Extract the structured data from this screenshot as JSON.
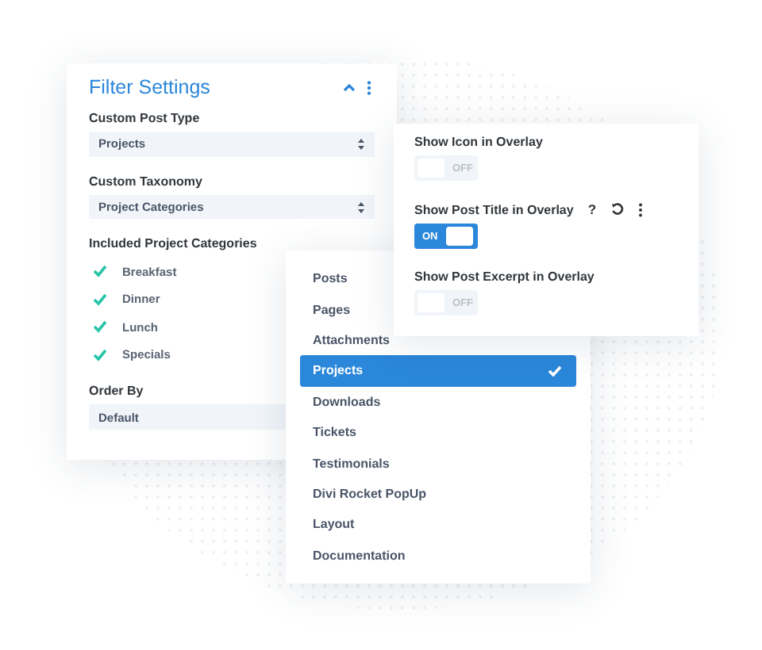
{
  "filter_panel": {
    "title": "Filter Settings",
    "fields": [
      {
        "label": "Custom Post Type",
        "value": "Projects"
      },
      {
        "label": "Custom Taxonomy",
        "value": "Project Categories"
      }
    ],
    "categories_label": "Included Project Categories",
    "categories": [
      {
        "label": "Breakfast",
        "checked": true
      },
      {
        "label": "Dinner",
        "checked": true
      },
      {
        "label": "Lunch",
        "checked": true
      },
      {
        "label": "Specials",
        "checked": true
      }
    ],
    "order_by": {
      "label": "Order By",
      "value": "Default"
    }
  },
  "overlay_panel": {
    "toggles": [
      {
        "label": "Show Icon in Overlay",
        "on": false,
        "text": "OFF"
      },
      {
        "label": "Show Post Title in Overlay",
        "on": true,
        "text": "ON",
        "actions": [
          {
            "kind": "help",
            "text": "?"
          },
          {
            "kind": "reset"
          },
          {
            "kind": "more"
          }
        ]
      },
      {
        "label": "Show Post Excerpt in Overlay",
        "on": false,
        "text": "OFF"
      }
    ]
  },
  "post_type_menu": {
    "items": [
      {
        "label": "Posts",
        "selected": false
      },
      {
        "label": "Pages",
        "selected": false
      },
      {
        "label": "Attachments",
        "selected": false
      },
      {
        "label": "Projects",
        "selected": true
      },
      {
        "label": "Downloads",
        "selected": false
      },
      {
        "label": "Tickets",
        "selected": false
      },
      {
        "label": "Testimonials",
        "selected": false
      },
      {
        "label": "Divi Rocket PopUp",
        "selected": false
      },
      {
        "label": "Layout",
        "selected": false
      },
      {
        "label": "Documentation",
        "selected": false
      }
    ]
  }
}
